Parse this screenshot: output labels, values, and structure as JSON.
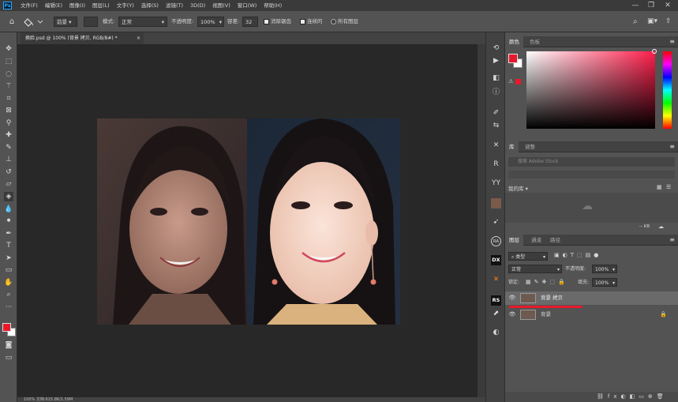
{
  "menubar": {
    "logo": "Ps",
    "items": [
      "文件(F)",
      "编辑(E)",
      "图像(I)",
      "图层(L)",
      "文字(Y)",
      "选择(S)",
      "滤镜(T)",
      "3D(D)",
      "视图(V)",
      "窗口(W)",
      "帮助(H)"
    ],
    "minimize": "—",
    "restore": "❐",
    "close": "✕"
  },
  "options": {
    "tool_icon": "paint-bucket-icon",
    "fill_source": "前景",
    "mode_label": "模式:",
    "mode_value": "正常",
    "opacity_label": "不透明度:",
    "opacity_value": "100%",
    "tolerance_label": "容差:",
    "tolerance_value": "32",
    "antialias_label": "消除锯齿",
    "contiguous_label": "连续的",
    "all_layers_label": "所有图层"
  },
  "document": {
    "tab_title": "换脸.psd @ 100% (背景 拷贝, RGB/8#) *",
    "tab_close": "×",
    "status_text": "100%    文档:615.8K/1.59M"
  },
  "color_panel": {
    "tabs": [
      "颜色",
      "色板"
    ],
    "fg_color": "#e8192c",
    "bg_color": "#ffffff",
    "hue_color": "#ff1e4b"
  },
  "libraries_panel": {
    "tabs": [
      "库",
      "调整"
    ],
    "search_placeholder": "搜索 Adobe Stock",
    "library_name": "我的库",
    "size_label": "-- KB"
  },
  "layers_panel": {
    "tabs": [
      "图层",
      "通道",
      "路径"
    ],
    "filter_label": "类型",
    "blend_mode": "正常",
    "opacity_label": "不透明度:",
    "opacity_value": "100%",
    "lock_label": "锁定:",
    "fill_label": "填充:",
    "fill_value": "100%",
    "layers": [
      {
        "name": "背景 拷贝",
        "selected": true,
        "locked": false
      },
      {
        "name": "背景",
        "selected": false,
        "locked": true
      }
    ]
  },
  "dock": {
    "ra_label": "RA",
    "dx_label": "DX",
    "rs_label": "RS",
    "yy_label": "YY",
    "r_label": "R"
  }
}
